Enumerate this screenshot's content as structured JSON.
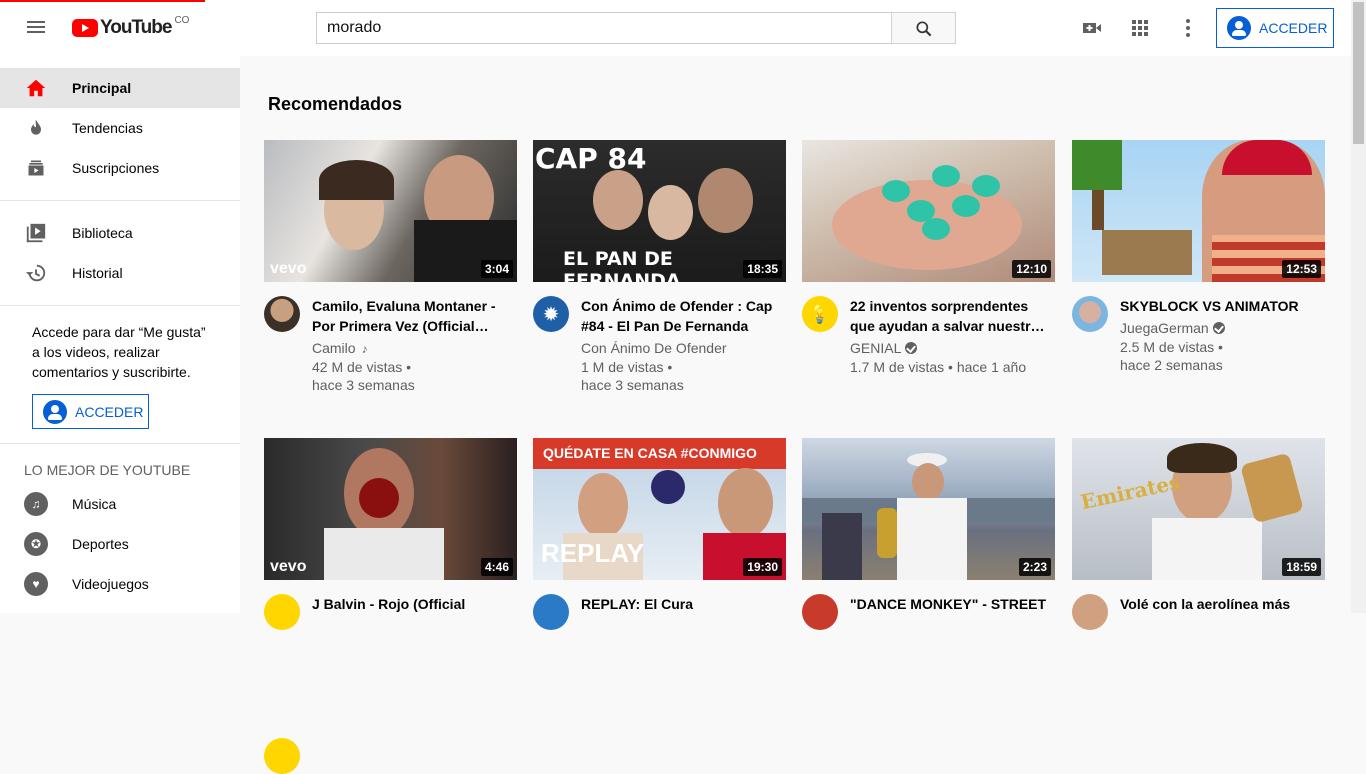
{
  "header": {
    "logo_text": "YouTube",
    "country_code": "CO",
    "search_value": "morado",
    "signin_label": "ACCEDER"
  },
  "sidebar": {
    "items": [
      {
        "label": "Principal",
        "icon": "home-icon"
      },
      {
        "label": "Tendencias",
        "icon": "fire-icon"
      },
      {
        "label": "Suscripciones",
        "icon": "subscriptions-icon"
      },
      {
        "label": "Biblioteca",
        "icon": "library-icon"
      },
      {
        "label": "Historial",
        "icon": "history-icon"
      }
    ],
    "signin_prompt": "Accede para dar “Me gusta” a los videos, realizar comentarios y suscribirte.",
    "signin_label": "ACCEDER",
    "best_heading": "LO MEJOR DE YOUTUBE",
    "best_items": [
      {
        "label": "Música",
        "icon": "music-icon"
      },
      {
        "label": "Deportes",
        "icon": "sports-icon"
      },
      {
        "label": "Videojuegos",
        "icon": "gaming-icon"
      }
    ]
  },
  "main": {
    "section_title": "Recomendados",
    "videos": [
      {
        "title": "Camilo, Evaluna Montaner - Por Primera Vez (Official…",
        "channel": "Camilo",
        "views": "42 M de vistas •",
        "age": "hace 3 semanas",
        "duration": "3:04",
        "badge": "music-note",
        "thumb_color": "#8a8f96"
      },
      {
        "title": "Con Ánimo de Ofender : Cap #84 - El Pan De Fernanda",
        "channel": "Con Ánimo De Ofender",
        "views": "1 M de vistas •",
        "age": "hace 3 semanas",
        "duration": "18:35",
        "badge": "",
        "thumb_color": "#2a2a2a",
        "overlay_top": "CAP 84",
        "overlay_bottom": "EL PAN DE FERNANDA"
      },
      {
        "title": "22 inventos sorprendentes que ayudan a salvar nuestr…",
        "channel": "GENIAL",
        "views": "1.7 M de vistas • hace 1 año",
        "age": "",
        "duration": "12:10",
        "badge": "verified",
        "thumb_color": "#c9b8a8"
      },
      {
        "title": "SKYBLOCK VS ANIMATOR",
        "channel": "JuegaGerman",
        "views": "2.5 M de vistas •",
        "age": "hace 2 semanas",
        "duration": "12:53",
        "badge": "verified",
        "thumb_color": "#8fc1e8"
      },
      {
        "title": "J Balvin - Rojo (Official",
        "channel": "",
        "views": "",
        "age": "",
        "duration": "4:46",
        "badge": "",
        "thumb_color": "#3a3a3a"
      },
      {
        "title": "REPLAY: El Cura",
        "channel": "",
        "views": "",
        "age": "",
        "duration": "19:30",
        "badge": "",
        "thumb_color": "#c23a2a",
        "overlay_top": "QUÉDATE EN CASA #CONMIGO",
        "overlay_bottom": "REPLAY"
      },
      {
        "title": "\"DANCE MONKEY\" - STREET",
        "channel": "",
        "views": "",
        "age": "",
        "duration": "2:23",
        "badge": "",
        "thumb_color": "#7a8aa0"
      },
      {
        "title": "Volé con la aerolínea más",
        "channel": "",
        "views": "",
        "age": "",
        "duration": "18:59",
        "badge": "",
        "thumb_color": "#c8ccd2",
        "overlay_top": "Emirates"
      }
    ]
  },
  "colors": {
    "accent": "#065fd4",
    "brand": "#ff0000"
  }
}
